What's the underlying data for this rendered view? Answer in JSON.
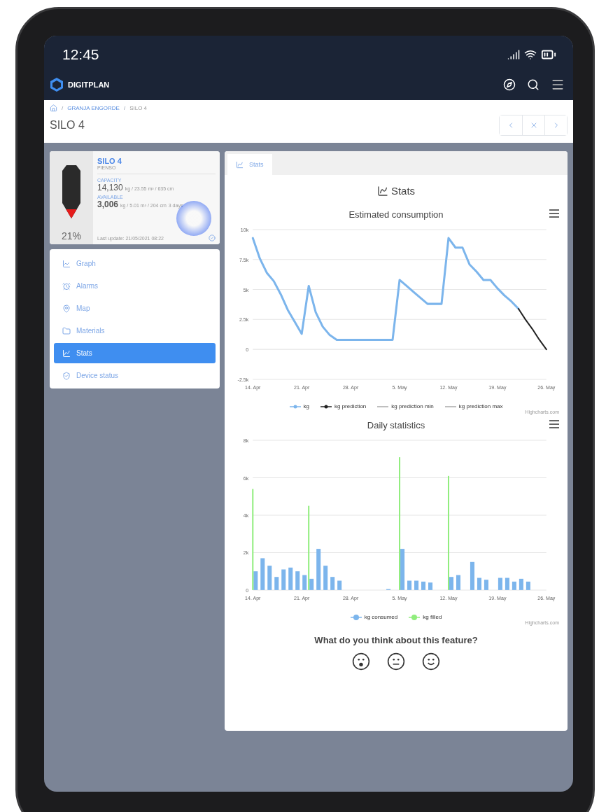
{
  "status_bar": {
    "time": "12:45"
  },
  "app_bar": {
    "brand": "DIGITPLAN"
  },
  "breadcrumb": {
    "separator": "/",
    "items": [
      "GRANJA ENGORDE",
      "SILO 4"
    ]
  },
  "page_title": "SILO 4",
  "silo": {
    "name": "SILO 4",
    "material": "PIENSO",
    "level": 0.21,
    "percent": "21%",
    "capacity_label": "CAPACITY",
    "capacity_value": "14,130",
    "capacity_unit": "kg / 23.55 m³ / 635 cm",
    "available_label": "AVAILABLE",
    "available_value": "3,006",
    "available_unit": "kg / 5.01 m³ / 204 cm",
    "days_left": "3 days",
    "last_update": "Last update: 21/05/2021 08:22"
  },
  "menu": [
    {
      "kind": "graph",
      "label": "Graph",
      "selected": false
    },
    {
      "kind": "alarms",
      "label": "Alarms",
      "selected": false
    },
    {
      "kind": "map",
      "label": "Map",
      "selected": false
    },
    {
      "kind": "materials",
      "label": "Materials",
      "selected": false
    },
    {
      "kind": "stats",
      "label": "Stats",
      "selected": true
    },
    {
      "kind": "device",
      "label": "Device status",
      "selected": false
    }
  ],
  "tabs": [
    {
      "label": "Stats",
      "selected": true
    }
  ],
  "section_title": "Stats",
  "charts": [
    {
      "title": "Estimated consumption",
      "credit": "Highcharts.com",
      "chart_data": {
        "type": "line",
        "grid": true,
        "categories": [
          "14. Apr",
          null,
          null,
          null,
          null,
          null,
          null,
          "21. Apr",
          null,
          null,
          null,
          null,
          null,
          null,
          "28. Apr",
          null,
          null,
          null,
          null,
          null,
          null,
          "5. May",
          null,
          null,
          null,
          null,
          null,
          null,
          "12. May",
          null,
          null,
          null,
          null,
          null,
          null,
          "19. May",
          null,
          null,
          null,
          null,
          null,
          null,
          "26. May"
        ],
        "ylim": [
          -2500,
          10000
        ],
        "yticks": [
          {
            "value": -2500,
            "label": "-2.5k"
          },
          {
            "value": 0,
            "label": "0"
          },
          {
            "value": 2500,
            "label": "2.5k"
          },
          {
            "value": 5000,
            "label": "5k"
          },
          {
            "value": 7500,
            "label": "7.5k"
          },
          {
            "value": 10000,
            "label": "10k"
          }
        ],
        "series": [
          {
            "name": "kg",
            "color": "#7cb5ec",
            "values": [
              9300,
              7600,
              6400,
              5700,
              4600,
              3300,
              2300,
              1300,
              5300,
              3100,
              1900,
              1200,
              800,
              800,
              800,
              800,
              800,
              800,
              800,
              800,
              800,
              5800,
              5300,
              4800,
              4300,
              3800,
              3800,
              3800,
              9300,
              8500,
              8500,
              7100,
              6500,
              5800,
              5800,
              5100,
              4500,
              4000,
              3400,
              null,
              null,
              null,
              null
            ]
          },
          {
            "name": "kg prediction",
            "color": "#222222",
            "values": [
              null,
              null,
              null,
              null,
              null,
              null,
              null,
              null,
              null,
              null,
              null,
              null,
              null,
              null,
              null,
              null,
              null,
              null,
              null,
              null,
              null,
              null,
              null,
              null,
              null,
              null,
              null,
              null,
              null,
              null,
              null,
              null,
              null,
              null,
              null,
              null,
              null,
              null,
              3400,
              2500,
              1700,
              800,
              0
            ]
          },
          {
            "name": "kg prediction min",
            "color": "#aaaaaa",
            "values": [
              null,
              null,
              null,
              null,
              null,
              null,
              null,
              null,
              null,
              null,
              null,
              null,
              null,
              null,
              null,
              null,
              null,
              null,
              null,
              null,
              null,
              null,
              null,
              null,
              null,
              null,
              null,
              null,
              null,
              null,
              null,
              null,
              null,
              null,
              null,
              null,
              null,
              null,
              null,
              null,
              null,
              null,
              null
            ]
          },
          {
            "name": "kg prediction max",
            "color": "#aaaaaa",
            "values": [
              null,
              null,
              null,
              null,
              null,
              null,
              null,
              null,
              null,
              null,
              null,
              null,
              null,
              null,
              null,
              null,
              null,
              null,
              null,
              null,
              null,
              null,
              null,
              null,
              null,
              null,
              null,
              null,
              null,
              null,
              null,
              null,
              null,
              null,
              null,
              null,
              null,
              null,
              null,
              null,
              null,
              null,
              null
            ]
          }
        ]
      }
    },
    {
      "title": "Daily statistics",
      "credit": "Highcharts.com",
      "chart_data": {
        "type": "bar",
        "grid": true,
        "categories": [
          "14. Apr",
          null,
          null,
          null,
          null,
          null,
          null,
          "21. Apr",
          null,
          null,
          null,
          null,
          null,
          null,
          "28. Apr",
          null,
          null,
          null,
          null,
          null,
          null,
          "5. May",
          null,
          null,
          null,
          null,
          null,
          null,
          "12. May",
          null,
          null,
          null,
          null,
          null,
          null,
          "19. May",
          null,
          null,
          null,
          null,
          null,
          null,
          "26. May"
        ],
        "ylim": [
          0,
          8000
        ],
        "yticks": [
          {
            "value": 0,
            "label": "0"
          },
          {
            "value": 2000,
            "label": "2k"
          },
          {
            "value": 4000,
            "label": "4k"
          },
          {
            "value": 6000,
            "label": "6k"
          },
          {
            "value": 8000,
            "label": "8k"
          }
        ],
        "series": [
          {
            "name": "kg consumed",
            "color": "#7cb5ec",
            "values": [
              1000,
              1700,
              1300,
              700,
              1100,
              1200,
              1000,
              800,
              600,
              2200,
              1300,
              700,
              500,
              0,
              0,
              0,
              0,
              0,
              0,
              50,
              0,
              2200,
              500,
              500,
              450,
              400,
              0,
              0,
              700,
              800,
              0,
              1500,
              650,
              550,
              0,
              650,
              650,
              450,
              600,
              450,
              0,
              0,
              0
            ]
          },
          {
            "name": "kg filled",
            "color": "#90ed7d",
            "values": [
              5400,
              null,
              null,
              null,
              null,
              null,
              null,
              null,
              4500,
              null,
              null,
              null,
              null,
              null,
              null,
              null,
              null,
              null,
              null,
              null,
              null,
              7100,
              null,
              null,
              null,
              null,
              null,
              null,
              6100,
              null,
              null,
              null,
              null,
              null,
              null,
              null,
              null,
              null,
              null,
              null,
              null,
              null,
              null
            ]
          }
        ]
      }
    }
  ],
  "feedback": {
    "question": "What do you think about this feature?",
    "options": [
      {
        "kind": "surprised"
      },
      {
        "kind": "neutral"
      },
      {
        "kind": "happy"
      }
    ]
  }
}
